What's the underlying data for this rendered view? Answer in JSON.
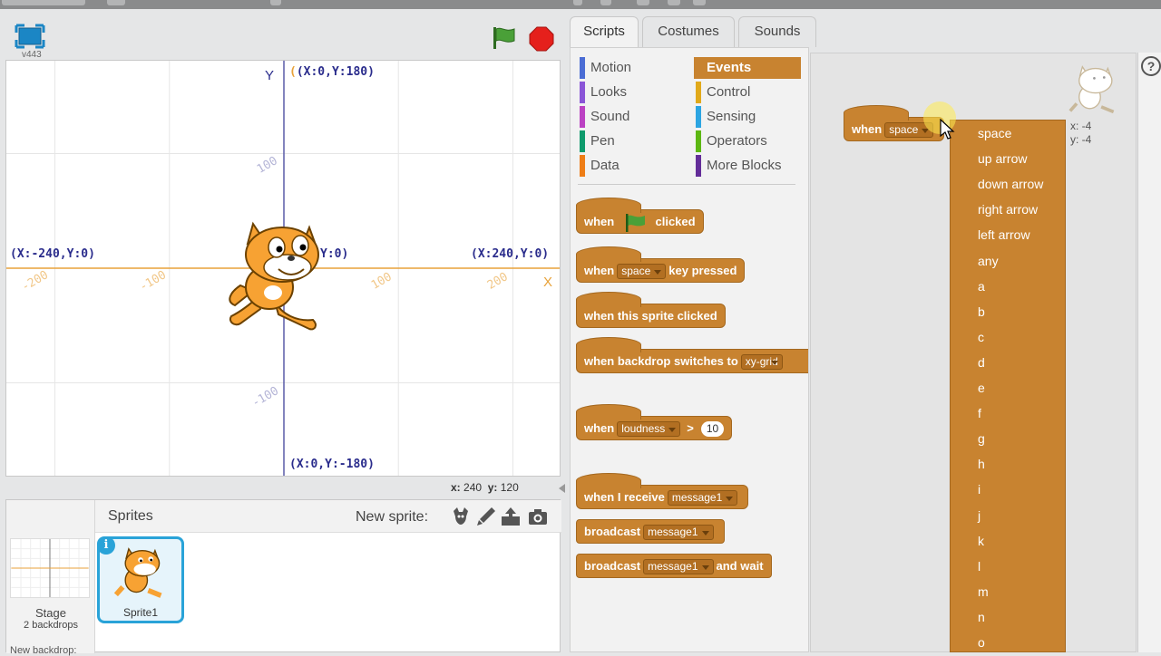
{
  "stage": {
    "version": "v443",
    "mouse_x_label": "x:",
    "mouse_x": "240",
    "mouse_y_label": "y:",
    "mouse_y": "120",
    "axis_x": "X",
    "axis_y": "Y",
    "coords": {
      "top": "(X:0,Y:180)",
      "bottom": "(X:0,Y:-180)",
      "left": "(X:-240,Y:0)",
      "right": "(X:240,Y:0)",
      "center": "Y:0)"
    },
    "tick_labels": {
      "x_neg200": "-200",
      "x_neg100": "-100",
      "x_100": "100",
      "x_200": "200",
      "y_100": "100",
      "y_neg100": "-100"
    }
  },
  "sprites_pane": {
    "title": "Sprites",
    "new_sprite_label": "New sprite:",
    "stage_label": "Stage",
    "stage_sub": "2 backdrops",
    "new_backdrop": "New backdrop:",
    "sprite_name": "Sprite1",
    "info": "i"
  },
  "tabs": [
    "Scripts",
    "Costumes",
    "Sounds"
  ],
  "categories_left": [
    {
      "label": "Motion",
      "color": "#4a6cd4"
    },
    {
      "label": "Looks",
      "color": "#8a55d7"
    },
    {
      "label": "Sound",
      "color": "#bb42c3"
    },
    {
      "label": "Pen",
      "color": "#0e9a6c"
    },
    {
      "label": "Data",
      "color": "#ee7d16"
    }
  ],
  "categories_right": [
    {
      "label": "Events",
      "color": "#c88330"
    },
    {
      "label": "Control",
      "color": "#e1a91a"
    },
    {
      "label": "Sensing",
      "color": "#2ca5e2"
    },
    {
      "label": "Operators",
      "color": "#5cb712"
    },
    {
      "label": "More Blocks",
      "color": "#632d99"
    }
  ],
  "blocks": {
    "flag_when": "when",
    "flag_clicked": "clicked",
    "key_when": "when",
    "key_value": "space",
    "key_pressed": "key pressed",
    "sprite_clicked": "when this sprite clicked",
    "backdrop_when": "when backdrop switches to",
    "backdrop_value": "xy-grid",
    "loud_when": "when",
    "loud_value": "loudness",
    "loud_gt": ">",
    "loud_num": "10",
    "receive_when": "when I receive",
    "receive_value": "message1",
    "broadcast": "broadcast",
    "broadcast_value": "message1",
    "broadcast_wait": "broadcast",
    "broadcast_wait_value": "message1",
    "broadcast_wait_suffix": "and wait"
  },
  "script_area": {
    "hat_when": "when",
    "hat_value": "space",
    "x_readout": "x: -4",
    "y_readout": "y: -4"
  },
  "dropdown_options": [
    "space",
    "up arrow",
    "down arrow",
    "right arrow",
    "left arrow",
    "any",
    "a",
    "b",
    "c",
    "d",
    "e",
    "f",
    "g",
    "h",
    "i",
    "j",
    "k",
    "l",
    "m",
    "n",
    "o"
  ],
  "help": "?"
}
